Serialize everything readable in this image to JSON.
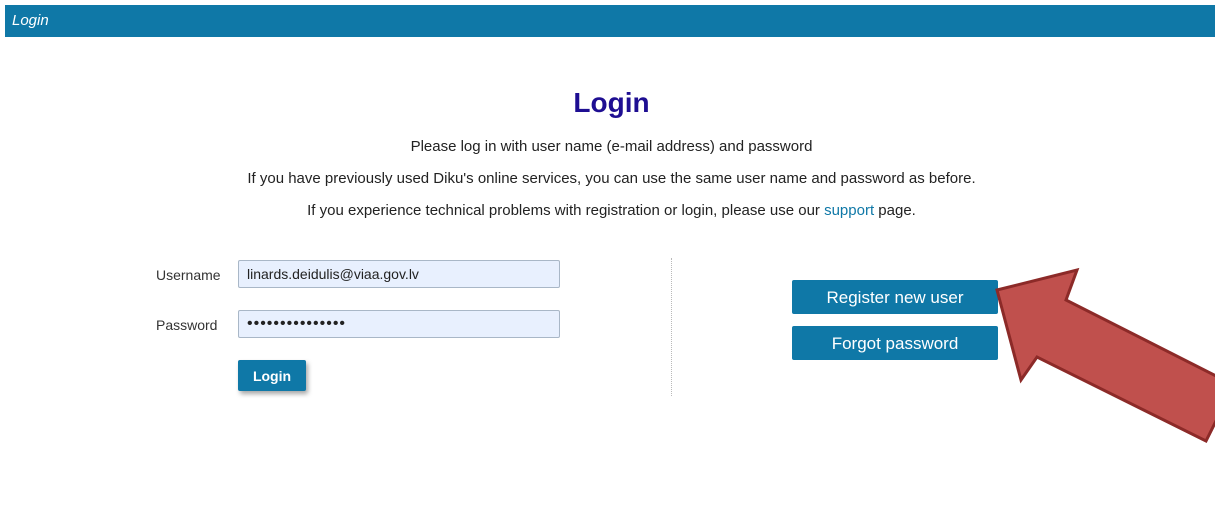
{
  "header": {
    "title": "Login"
  },
  "main": {
    "heading": "Login",
    "intro_line_1": "Please log in with user name (e-mail address) and password",
    "intro_line_2": "If you have previously used Diku's online services, you can use the same user name and password as before.",
    "intro_line_3_before": "If you experience technical problems with registration or login, please use our ",
    "intro_line_3_link": "support",
    "intro_line_3_after": " page."
  },
  "form": {
    "username_label": "Username",
    "username_value": "linards.deidulis@viaa.gov.lv",
    "password_label": "Password",
    "password_value": "•••••••••••••••",
    "login_label": "Login"
  },
  "actions": {
    "register_label": "Register new user",
    "forgot_label": "Forgot password"
  },
  "annotation": {
    "icon": "arrow-icon",
    "color": "#c0504d",
    "stroke_color": "#8c2a28"
  },
  "colors": {
    "brand": "#0f78a7",
    "heading": "#1e0e92",
    "input_bg": "#e8f0fe"
  }
}
